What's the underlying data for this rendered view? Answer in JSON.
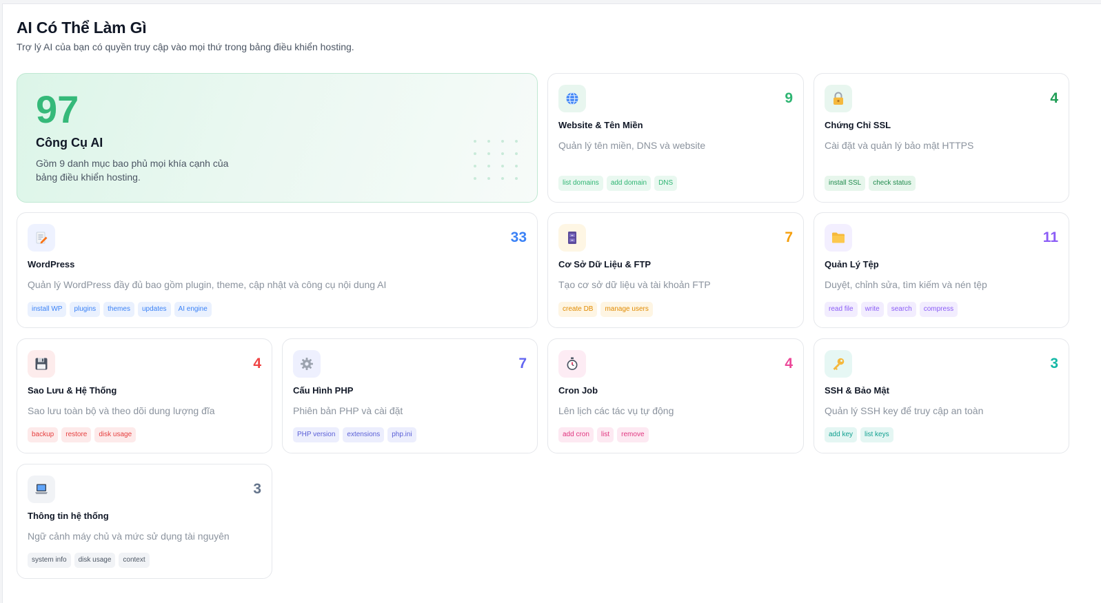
{
  "header": {
    "title": "AI Có Thể Làm Gì",
    "subtitle": "Trợ lý AI của bạn có quyền truy cập vào mọi thứ trong bảng điều khiển hosting."
  },
  "summary": {
    "count": "97",
    "label": "Công Cụ AI",
    "description": "Gồm 9 danh mục bao phủ mọi khía cạnh của bảng điều khiển hosting."
  },
  "categories": [
    {
      "title": "Website & Tên Miền",
      "count": "9",
      "description": "Quản lý tên miền, DNS và website",
      "icon": "globe-icon",
      "accent": "#2fb573",
      "tags": [
        "list domains",
        "add domain",
        "DNS"
      ]
    },
    {
      "title": "Chứng Chỉ SSL",
      "count": "4",
      "description": "Cài đặt và quản lý bảo mật HTTPS",
      "icon": "lock-icon",
      "accent": "#1f9d55",
      "tags": [
        "install SSL",
        "check status"
      ]
    },
    {
      "title": "WordPress",
      "count": "33",
      "description": "Quản lý WordPress đầy đủ bao gồm plugin, theme, cập nhật và công cụ nội dung AI",
      "icon": "memo-icon",
      "accent": "#3b82f6",
      "tags": [
        "install WP",
        "plugins",
        "themes",
        "updates",
        "AI engine"
      ]
    },
    {
      "title": "Cơ Sở Dữ Liệu & FTP",
      "count": "7",
      "description": "Tạo cơ sở dữ liệu và tài khoản FTP",
      "icon": "file-cabinet-icon",
      "accent": "#f59e0b",
      "tags": [
        "create DB",
        "manage users"
      ]
    },
    {
      "title": "Quản Lý Tệp",
      "count": "11",
      "description": "Duyệt, chỉnh sửa, tìm kiếm và nén tệp",
      "icon": "folder-icon",
      "accent": "#8b5cf6",
      "tags": [
        "read file",
        "write",
        "search",
        "compress"
      ]
    },
    {
      "title": "Sao Lưu & Hệ Thống",
      "count": "4",
      "description": "Sao lưu toàn bộ và theo dõi dung lượng đĩa",
      "icon": "floppy-disk-icon",
      "accent": "#ef4444",
      "tags": [
        "backup",
        "restore",
        "disk usage"
      ]
    },
    {
      "title": "Cấu Hình PHP",
      "count": "7",
      "description": "Phiên bản PHP và cài đặt",
      "icon": "gear-icon",
      "accent": "#6366f1",
      "tags": [
        "PHP version",
        "extensions",
        "php.ini"
      ]
    },
    {
      "title": "Cron Job",
      "count": "4",
      "description": "Lên lịch các tác vụ tự động",
      "icon": "stopwatch-icon",
      "accent": "#ec4899",
      "tags": [
        "add cron",
        "list",
        "remove"
      ]
    },
    {
      "title": "SSH & Bảo Mật",
      "count": "3",
      "description": "Quản lý SSH key để truy cập an toàn",
      "icon": "key-icon",
      "accent": "#14b8a6",
      "tags": [
        "add key",
        "list keys"
      ]
    },
    {
      "title": "Thông tin hệ thống",
      "count": "3",
      "description": "Ngữ cảnh máy chủ và mức sử dụng tài nguyên",
      "icon": "laptop-icon",
      "accent": "#64748b",
      "tags": [
        "system info",
        "disk usage",
        "context"
      ]
    }
  ]
}
